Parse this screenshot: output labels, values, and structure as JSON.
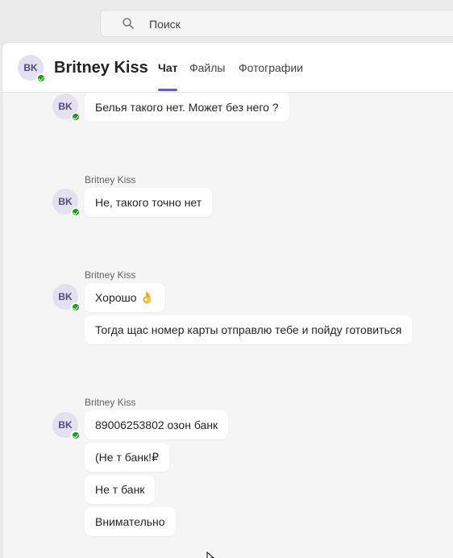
{
  "search": {
    "placeholder": "Поиск"
  },
  "chat": {
    "avatar_initials": "BK",
    "title": "Britney Kiss",
    "tabs": [
      {
        "label": "Чат",
        "active": true
      },
      {
        "label": "Файлы",
        "active": false
      },
      {
        "label": "Фотографии",
        "active": false
      }
    ]
  },
  "messages": {
    "group0": {
      "avatar": "BK",
      "bubbles": [
        "Белья такого нет. Может без него ?"
      ]
    },
    "group1": {
      "sender": "Britney Kiss",
      "avatar": "BK",
      "bubbles": [
        "Не, такого точно нет"
      ]
    },
    "group2": {
      "sender": "Britney Kiss",
      "avatar": "BK",
      "bubbles": [
        "Хорошо 👌",
        "Тогда щас номер карты отправлю тебе и пойду готовиться"
      ]
    },
    "group3": {
      "sender": "Britney Kiss",
      "avatar": "BK",
      "bubbles": [
        "89006253802 озон банк",
        "(Не т банк!₽",
        "Не т банк",
        "Внимательно"
      ]
    }
  },
  "colors": {
    "accent": "#5b5fc7",
    "presence": "#13a10e",
    "bubble": "#ffffff",
    "background": "#f5f5f5"
  }
}
